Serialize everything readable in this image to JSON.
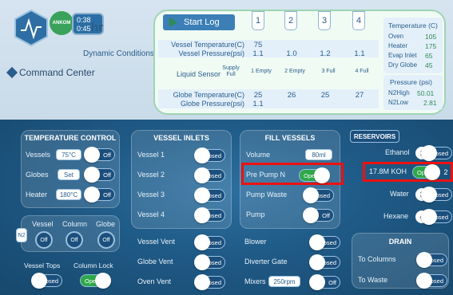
{
  "header": {
    "badge": "ANKOM",
    "timer_line1": "0:38",
    "timer_line2": "0:45",
    "timer_unit": "hr",
    "dynamic_conditions": "Dynamic Conditions",
    "command_center": "Command Center"
  },
  "log": {
    "start_label": "Start Log",
    "vessels": [
      "1",
      "2",
      "3",
      "4"
    ],
    "rows": [
      {
        "label": "Vessel Temperature(C)",
        "values": [
          "75",
          "",
          "",
          ""
        ]
      },
      {
        "label": "Vessel Pressure(psi)",
        "values": [
          "1.1",
          "1.0",
          "1.2",
          "1.1"
        ]
      },
      {
        "label": "Liquid Sensor",
        "values": [
          "Supply Full",
          "1 Empty",
          "2 Empty",
          "3 Full",
          "4 Full"
        ]
      },
      {
        "label": "Globe Temperature(C)",
        "values": [
          "25",
          "26",
          "25",
          "27"
        ]
      },
      {
        "label": "Globe Pressure(psi)",
        "values": [
          "1.1",
          "",
          "",
          ""
        ]
      }
    ],
    "temperature_title": "Temperature (C)",
    "temps": [
      {
        "label": "Oven",
        "value": "105"
      },
      {
        "label": "Heater",
        "value": "175"
      },
      {
        "label": "Evap Inlet",
        "value": "65"
      },
      {
        "label": "Dry Globe",
        "value": "45"
      }
    ],
    "pressure_title": "Pressure (psi)",
    "pressures": [
      {
        "label": "N2High",
        "value": "50.01"
      },
      {
        "label": "N2Low",
        "value": "2.81"
      }
    ]
  },
  "temp_control": {
    "title": "TEMPERATURE CONTROL",
    "rows": [
      {
        "label": "Vessels",
        "chip": "75°C",
        "state": "Off"
      },
      {
        "label": "Globes",
        "chip": "Set",
        "state": "Off"
      },
      {
        "label": "Heater",
        "chip": "180°C",
        "state": "Off"
      }
    ]
  },
  "n2": {
    "tag": "N2",
    "headers": [
      "Vessel",
      "Column",
      "Globe"
    ],
    "states": [
      "Off",
      "Off",
      "Off"
    ]
  },
  "bottom_left": {
    "vessel_tops": "Vessel Tops",
    "vessel_tops_state": "Closed",
    "column_lock": "Column Lock",
    "column_lock_state": "Open"
  },
  "vessel_inlets": {
    "title": "VESSEL INLETS",
    "rows": [
      {
        "label": "Vessel 1",
        "state": "Closed"
      },
      {
        "label": "Vessel 2",
        "state": "Closed"
      },
      {
        "label": "Vessel 3",
        "state": "Closed"
      },
      {
        "label": "Vessel 4",
        "state": "Closed"
      }
    ],
    "extra": [
      {
        "label": "Vessel Vent",
        "state": "Closed"
      },
      {
        "label": "Globe Vent",
        "state": "Closed"
      },
      {
        "label": "Oven Vent",
        "state": "Closed"
      }
    ]
  },
  "fill": {
    "title": "FILL VESSELS",
    "volume_label": "Volume",
    "volume_value": "80ml",
    "rows": [
      {
        "label": "Pre Pump N",
        "state": "Open"
      },
      {
        "label": "Pump Waste",
        "state": "Closed"
      },
      {
        "label": "Pump",
        "state": "Off"
      }
    ],
    "extra": [
      {
        "label": "Blower",
        "state": "Closed"
      },
      {
        "label": "Diverter Gate",
        "state": "Closed"
      },
      {
        "label": "Mixers",
        "chip": "250rpm",
        "state": "Off"
      }
    ]
  },
  "reservoirs": {
    "title": "RESERVOIRS",
    "rows": [
      {
        "label": "Ethanol",
        "num": "1",
        "state": "Closed"
      },
      {
        "label": "17.8M KOH",
        "num": "2",
        "state": "Open"
      },
      {
        "label": "Water",
        "num": "3",
        "state": "Closed"
      },
      {
        "label": "Hexane",
        "num": "4",
        "state": "Closed"
      }
    ]
  },
  "drain": {
    "title": "DRAIN",
    "rows": [
      {
        "label": "To Columns",
        "state": "Closed"
      },
      {
        "label": "To Waste",
        "state": "Closed"
      }
    ]
  }
}
